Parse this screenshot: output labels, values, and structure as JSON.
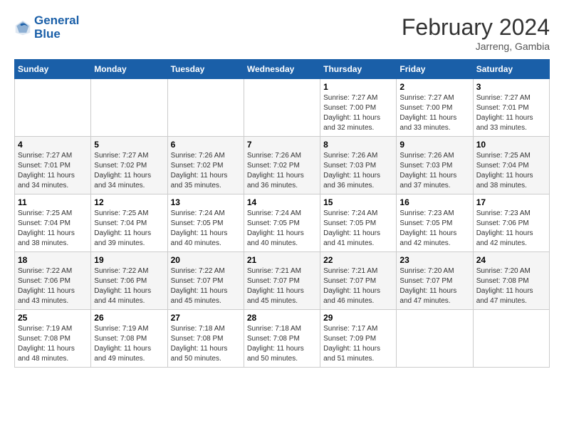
{
  "logo": {
    "line1": "General",
    "line2": "Blue"
  },
  "title": "February 2024",
  "location": "Jarreng, Gambia",
  "days_header": [
    "Sunday",
    "Monday",
    "Tuesday",
    "Wednesday",
    "Thursday",
    "Friday",
    "Saturday"
  ],
  "weeks": [
    [
      {
        "day": "",
        "info": ""
      },
      {
        "day": "",
        "info": ""
      },
      {
        "day": "",
        "info": ""
      },
      {
        "day": "",
        "info": ""
      },
      {
        "day": "1",
        "info": "Sunrise: 7:27 AM\nSunset: 7:00 PM\nDaylight: 11 hours\nand 32 minutes."
      },
      {
        "day": "2",
        "info": "Sunrise: 7:27 AM\nSunset: 7:00 PM\nDaylight: 11 hours\nand 33 minutes."
      },
      {
        "day": "3",
        "info": "Sunrise: 7:27 AM\nSunset: 7:01 PM\nDaylight: 11 hours\nand 33 minutes."
      }
    ],
    [
      {
        "day": "4",
        "info": "Sunrise: 7:27 AM\nSunset: 7:01 PM\nDaylight: 11 hours\nand 34 minutes."
      },
      {
        "day": "5",
        "info": "Sunrise: 7:27 AM\nSunset: 7:02 PM\nDaylight: 11 hours\nand 34 minutes."
      },
      {
        "day": "6",
        "info": "Sunrise: 7:26 AM\nSunset: 7:02 PM\nDaylight: 11 hours\nand 35 minutes."
      },
      {
        "day": "7",
        "info": "Sunrise: 7:26 AM\nSunset: 7:02 PM\nDaylight: 11 hours\nand 36 minutes."
      },
      {
        "day": "8",
        "info": "Sunrise: 7:26 AM\nSunset: 7:03 PM\nDaylight: 11 hours\nand 36 minutes."
      },
      {
        "day": "9",
        "info": "Sunrise: 7:26 AM\nSunset: 7:03 PM\nDaylight: 11 hours\nand 37 minutes."
      },
      {
        "day": "10",
        "info": "Sunrise: 7:25 AM\nSunset: 7:04 PM\nDaylight: 11 hours\nand 38 minutes."
      }
    ],
    [
      {
        "day": "11",
        "info": "Sunrise: 7:25 AM\nSunset: 7:04 PM\nDaylight: 11 hours\nand 38 minutes."
      },
      {
        "day": "12",
        "info": "Sunrise: 7:25 AM\nSunset: 7:04 PM\nDaylight: 11 hours\nand 39 minutes."
      },
      {
        "day": "13",
        "info": "Sunrise: 7:24 AM\nSunset: 7:05 PM\nDaylight: 11 hours\nand 40 minutes."
      },
      {
        "day": "14",
        "info": "Sunrise: 7:24 AM\nSunset: 7:05 PM\nDaylight: 11 hours\nand 40 minutes."
      },
      {
        "day": "15",
        "info": "Sunrise: 7:24 AM\nSunset: 7:05 PM\nDaylight: 11 hours\nand 41 minutes."
      },
      {
        "day": "16",
        "info": "Sunrise: 7:23 AM\nSunset: 7:05 PM\nDaylight: 11 hours\nand 42 minutes."
      },
      {
        "day": "17",
        "info": "Sunrise: 7:23 AM\nSunset: 7:06 PM\nDaylight: 11 hours\nand 42 minutes."
      }
    ],
    [
      {
        "day": "18",
        "info": "Sunrise: 7:22 AM\nSunset: 7:06 PM\nDaylight: 11 hours\nand 43 minutes."
      },
      {
        "day": "19",
        "info": "Sunrise: 7:22 AM\nSunset: 7:06 PM\nDaylight: 11 hours\nand 44 minutes."
      },
      {
        "day": "20",
        "info": "Sunrise: 7:22 AM\nSunset: 7:07 PM\nDaylight: 11 hours\nand 45 minutes."
      },
      {
        "day": "21",
        "info": "Sunrise: 7:21 AM\nSunset: 7:07 PM\nDaylight: 11 hours\nand 45 minutes."
      },
      {
        "day": "22",
        "info": "Sunrise: 7:21 AM\nSunset: 7:07 PM\nDaylight: 11 hours\nand 46 minutes."
      },
      {
        "day": "23",
        "info": "Sunrise: 7:20 AM\nSunset: 7:07 PM\nDaylight: 11 hours\nand 47 minutes."
      },
      {
        "day": "24",
        "info": "Sunrise: 7:20 AM\nSunset: 7:08 PM\nDaylight: 11 hours\nand 47 minutes."
      }
    ],
    [
      {
        "day": "25",
        "info": "Sunrise: 7:19 AM\nSunset: 7:08 PM\nDaylight: 11 hours\nand 48 minutes."
      },
      {
        "day": "26",
        "info": "Sunrise: 7:19 AM\nSunset: 7:08 PM\nDaylight: 11 hours\nand 49 minutes."
      },
      {
        "day": "27",
        "info": "Sunrise: 7:18 AM\nSunset: 7:08 PM\nDaylight: 11 hours\nand 50 minutes."
      },
      {
        "day": "28",
        "info": "Sunrise: 7:18 AM\nSunset: 7:08 PM\nDaylight: 11 hours\nand 50 minutes."
      },
      {
        "day": "29",
        "info": "Sunrise: 7:17 AM\nSunset: 7:09 PM\nDaylight: 11 hours\nand 51 minutes."
      },
      {
        "day": "",
        "info": ""
      },
      {
        "day": "",
        "info": ""
      }
    ]
  ]
}
